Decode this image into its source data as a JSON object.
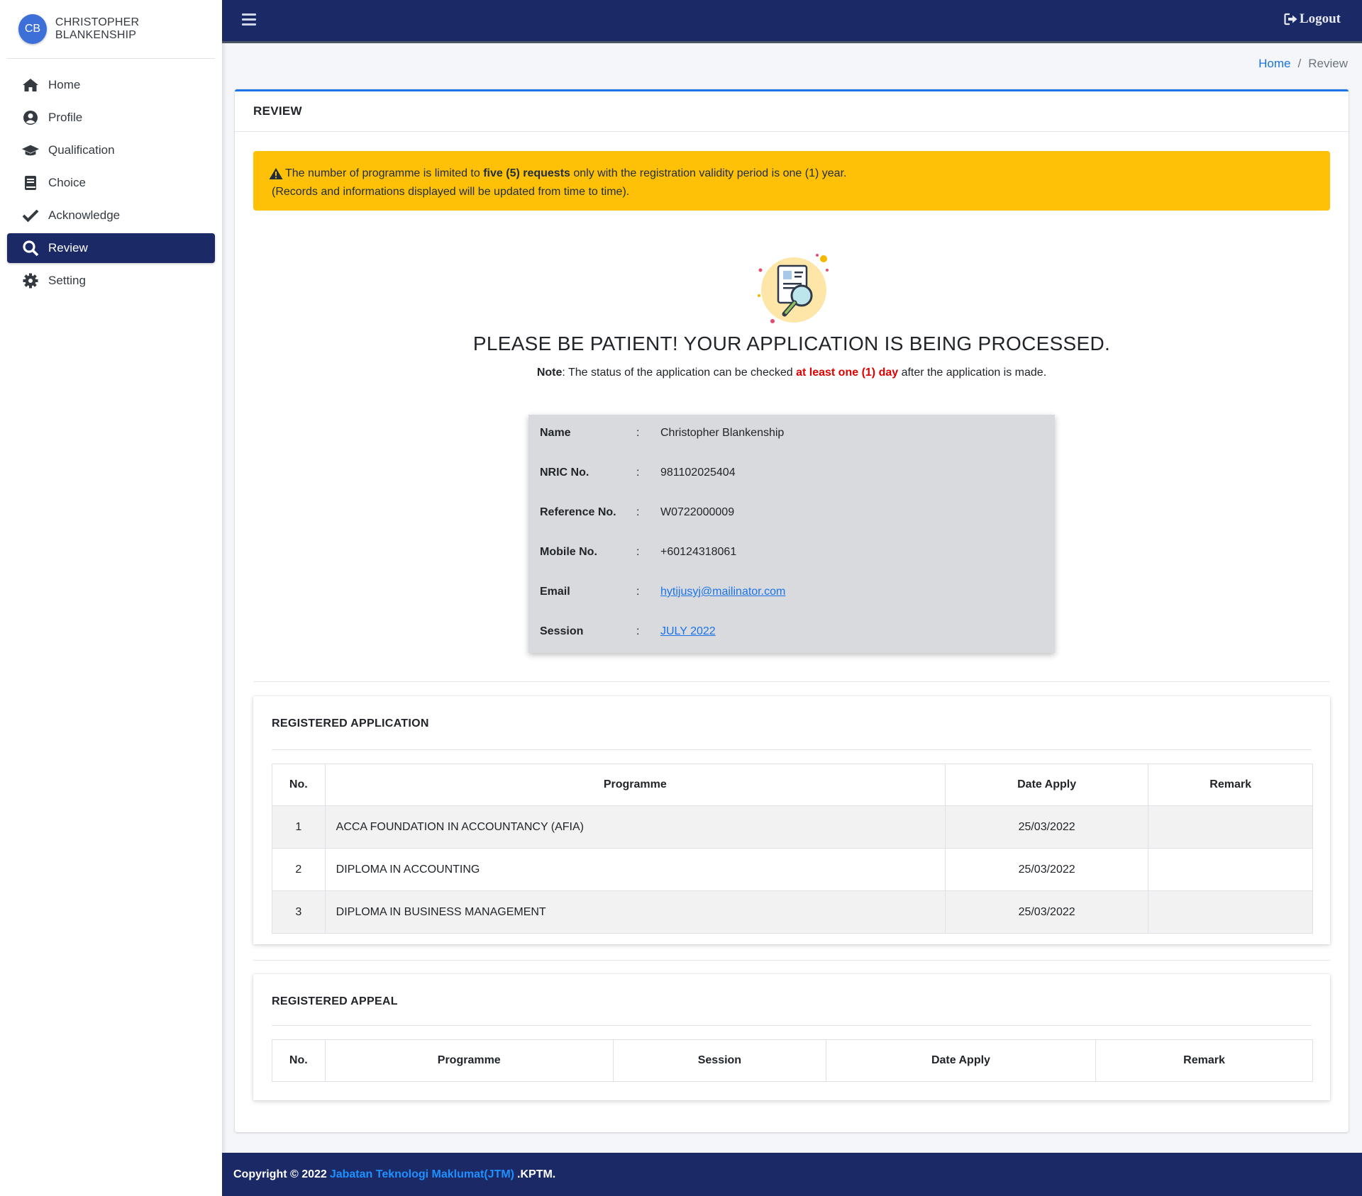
{
  "user": {
    "initials": "CB",
    "name": "CHRISTOPHER BLANKENSHIP"
  },
  "sidebar": {
    "items": [
      {
        "label": "Home",
        "icon": "home-icon"
      },
      {
        "label": "Profile",
        "icon": "user-circle-icon"
      },
      {
        "label": "Qualification",
        "icon": "graduation-cap-icon"
      },
      {
        "label": "Choice",
        "icon": "book-icon"
      },
      {
        "label": "Acknowledge",
        "icon": "check-icon"
      },
      {
        "label": "Review",
        "icon": "search-icon",
        "active": true
      },
      {
        "label": "Setting",
        "icon": "gear-icon"
      }
    ]
  },
  "topbar": {
    "logout_label": "Logout"
  },
  "breadcrumb": {
    "home": "Home",
    "separator": "/",
    "current": "Review"
  },
  "review": {
    "title": "REVIEW",
    "alert": {
      "text_before": "The number of programme is limited to ",
      "text_bold": "five (5) requests",
      "text_after": " only with the registration validity period is one (1) year.",
      "line2": "(Records and informations displayed will be updated from time to time)."
    },
    "headline": "PLEASE BE PATIENT! YOUR APPLICATION IS BEING PROCESSED.",
    "note": {
      "label": "Note",
      "text_before": ": The status of the application can be checked ",
      "highlight": "at least one (1) day",
      "text_after": " after the application is made."
    },
    "info": {
      "separator": ":",
      "name_label": "Name",
      "name": "Christopher Blankenship",
      "nric_label": "NRIC No.",
      "nric": "981102025404",
      "ref_label": "Reference No.",
      "ref": "W0722000009",
      "mobile_label": "Mobile No.",
      "mobile": "+60124318061",
      "email_label": "Email",
      "email": "hytijusyj@mailinator.com",
      "session_label": "Session",
      "session": "JULY 2022"
    }
  },
  "registered_application": {
    "title": "REGISTERED APPLICATION",
    "columns": [
      "No.",
      "Programme",
      "Date Apply",
      "Remark"
    ],
    "rows": [
      {
        "no": "1",
        "programme": "ACCA FOUNDATION IN ACCOUNTANCY (AFIA)",
        "date": "25/03/2022",
        "remark": ""
      },
      {
        "no": "2",
        "programme": "DIPLOMA IN ACCOUNTING",
        "date": "25/03/2022",
        "remark": ""
      },
      {
        "no": "3",
        "programme": "DIPLOMA IN BUSINESS MANAGEMENT",
        "date": "25/03/2022",
        "remark": ""
      }
    ]
  },
  "registered_appeal": {
    "title": "REGISTERED APPEAL",
    "columns": [
      "No.",
      "Programme",
      "Session",
      "Date Apply",
      "Remark"
    ]
  },
  "footer": {
    "prefix": "Copyright © 2022",
    "link": "Jabatan Teknologi Maklumat(JTM)",
    "suffix": ".KPTM."
  },
  "colors": {
    "navy": "#1b2a66",
    "accent": "#1e73e8",
    "warning": "#ffc107",
    "danger": "#e00000"
  }
}
